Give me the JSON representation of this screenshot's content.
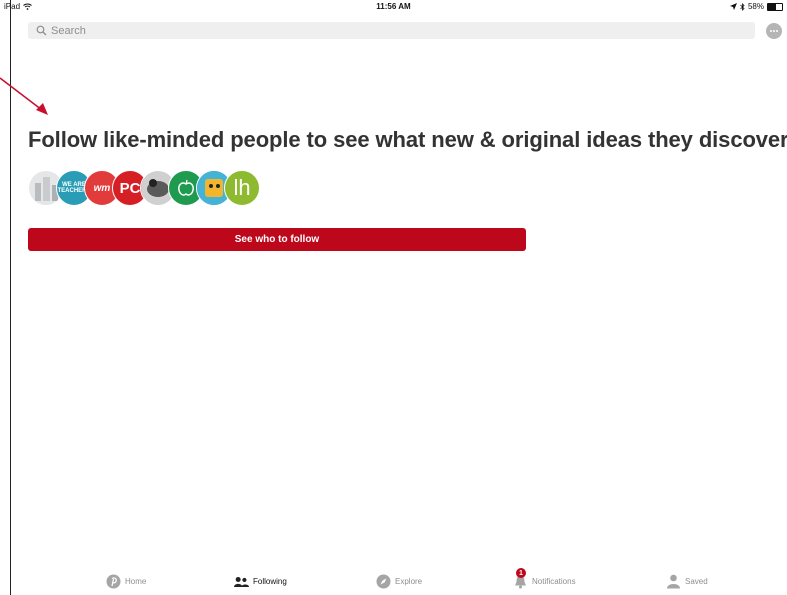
{
  "status_bar": {
    "device": "iPad",
    "time": "11:56 AM",
    "battery_text": "58%",
    "battery_level": 0.58,
    "icons": [
      "wifi-icon",
      "location-arrow-icon",
      "bluetooth-icon",
      "battery-icon"
    ]
  },
  "search": {
    "placeholder": "Search",
    "icon": "search-icon"
  },
  "header": {
    "message_icon": "chat-bubble-icon"
  },
  "main": {
    "headline": "Follow like-minded people to see what new & original ideas they discover",
    "avatars": [
      {
        "name": "building-avatar",
        "color": "#d8dadc"
      },
      {
        "name": "we-are-teachers-avatar",
        "label": "WE ARE TEACHERS",
        "color": "#2a9db6"
      },
      {
        "name": "red-logo-avatar",
        "label": "wm",
        "color": "#e23b3b"
      },
      {
        "name": "pc-avatar",
        "label": "PC",
        "color": "#d61e25"
      },
      {
        "name": "photo-avatar",
        "color": "#9a9a9a"
      },
      {
        "name": "apple-avatar",
        "color": "#1f9b4f"
      },
      {
        "name": "cartoon-avatar",
        "color": "#f2b62e"
      },
      {
        "name": "lh-avatar",
        "label": "lh",
        "color": "#8dba2f"
      }
    ],
    "cta_label": "See who to follow",
    "cta_color": "#bd081c"
  },
  "tabs": [
    {
      "label": "Home",
      "icon": "pinterest-icon",
      "active": false
    },
    {
      "label": "Following",
      "icon": "people-icon",
      "active": true
    },
    {
      "label": "Explore",
      "icon": "compass-icon",
      "active": false
    },
    {
      "label": "Notifications",
      "icon": "bell-icon",
      "active": false,
      "badge": "1"
    },
    {
      "label": "Saved",
      "icon": "person-icon",
      "active": false
    }
  ]
}
